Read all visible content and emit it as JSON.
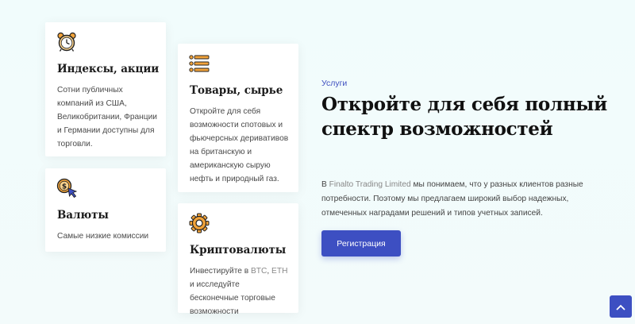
{
  "cards": [
    {
      "icon": "alarm-clock-icon",
      "title": "Индексы, акции",
      "text": "Сотни публичных компаний из США, Великобритании, Франции и Германии доступны для торговли."
    },
    {
      "icon": "coin-cursor-icon",
      "title": "Валюты",
      "text": "Самые низкие комиссии"
    },
    {
      "icon": "list-icon",
      "title": "Товары, сырье",
      "text": "Откройте для себя возможности спотовых и фьючерсных деривативов на британскую и американскую сырую нефть и природный газ."
    },
    {
      "icon": "gear-icon",
      "title": "Криптовалюты",
      "text_prefix": "Инвестируйте в ",
      "text_btc": "BTC",
      "text_sep": ", ",
      "text_eth": "ETH",
      "text_suffix": " и исследуйте бесконечные торговые возможности"
    }
  ],
  "hero": {
    "label": "Услуги",
    "title": "Откройте для себя полный спектр возможностей",
    "text_prefix": "В ",
    "text_brand": "Finalto Trading Limited",
    "text_suffix": " мы понимаем, что у разных клиентов разные потребности. Поэтому мы предлагаем широкий выбор надежных, отмеченных наградами решений и типов учетных записей.",
    "button_label": "Регистрация"
  },
  "colors": {
    "accent": "#3d4fc2",
    "icon_orange": "#f2a33a"
  },
  "scroll_top_icon": "chevron-up-icon"
}
